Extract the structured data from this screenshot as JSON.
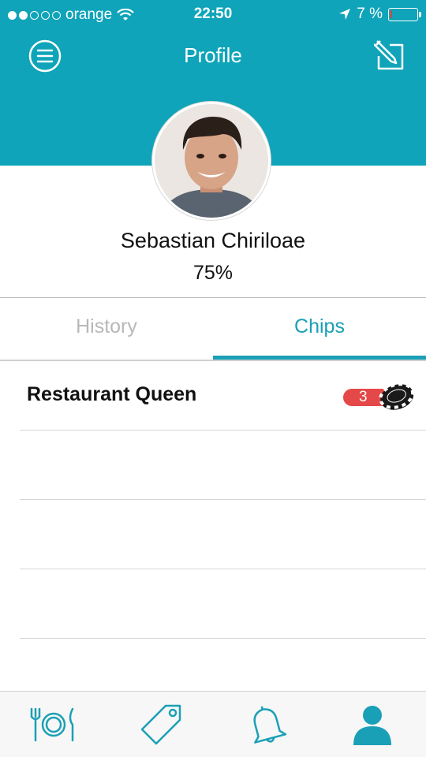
{
  "status_bar": {
    "carrier": "orange",
    "time": "22:50",
    "battery_text": "7 %",
    "signal_filled": 2,
    "signal_total": 5,
    "battery_level": 0.07
  },
  "header": {
    "title": "Profile"
  },
  "profile": {
    "name": "Sebastian Chiriloae",
    "percent": "75%"
  },
  "tabs": [
    {
      "label": "History",
      "active": false
    },
    {
      "label": "Chips",
      "active": true
    }
  ],
  "chips": [
    {
      "label": "Restaurant Queen",
      "count": "3"
    }
  ],
  "colors": {
    "accent": "#0fa4b9",
    "tab_active": "#1aa0b6",
    "badge": "#e54848"
  },
  "tabbar": {
    "items": [
      "restaurant-icon",
      "tag-icon",
      "bell-icon",
      "profile-icon"
    ]
  }
}
